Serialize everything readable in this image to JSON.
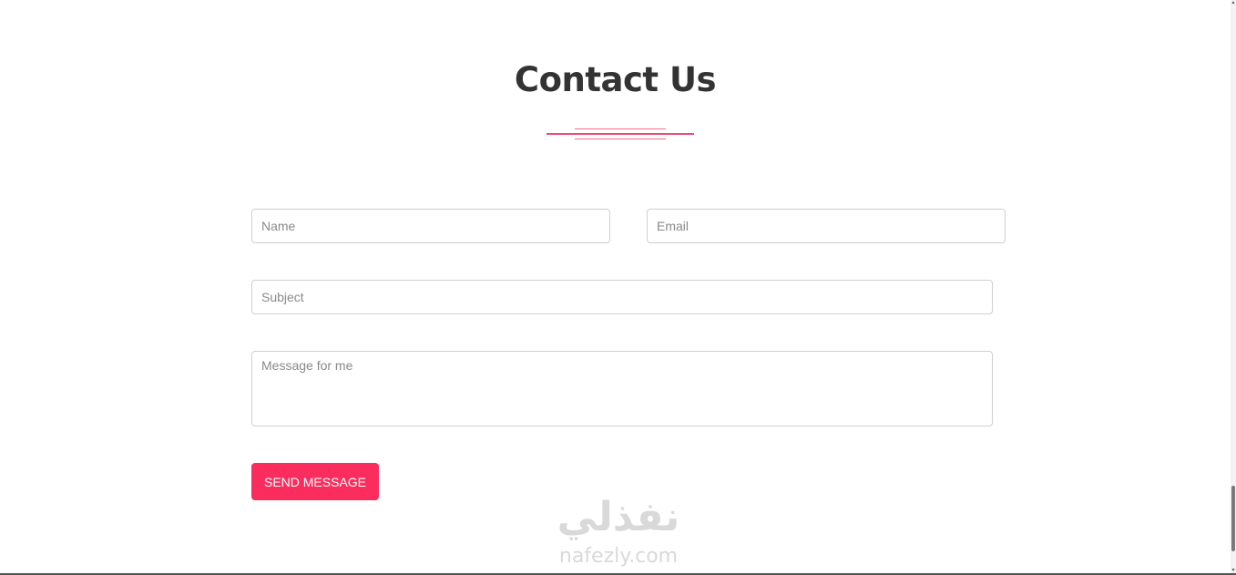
{
  "contact": {
    "title": "Contact Us",
    "name_placeholder": "Name",
    "email_placeholder": "Email",
    "subject_placeholder": "Subject",
    "message_placeholder": "Message for me",
    "send_label": "SEND MESSAGE"
  },
  "watermark": {
    "arabic": "نفذلي",
    "latin": "nafezly.com"
  },
  "colors": {
    "accent": "#fb2d5e",
    "divider": "#ea4f77",
    "title": "#333333"
  },
  "icons": {
    "scroll_up": "chevron-up-icon",
    "scroll_down": "chevron-down-icon"
  }
}
